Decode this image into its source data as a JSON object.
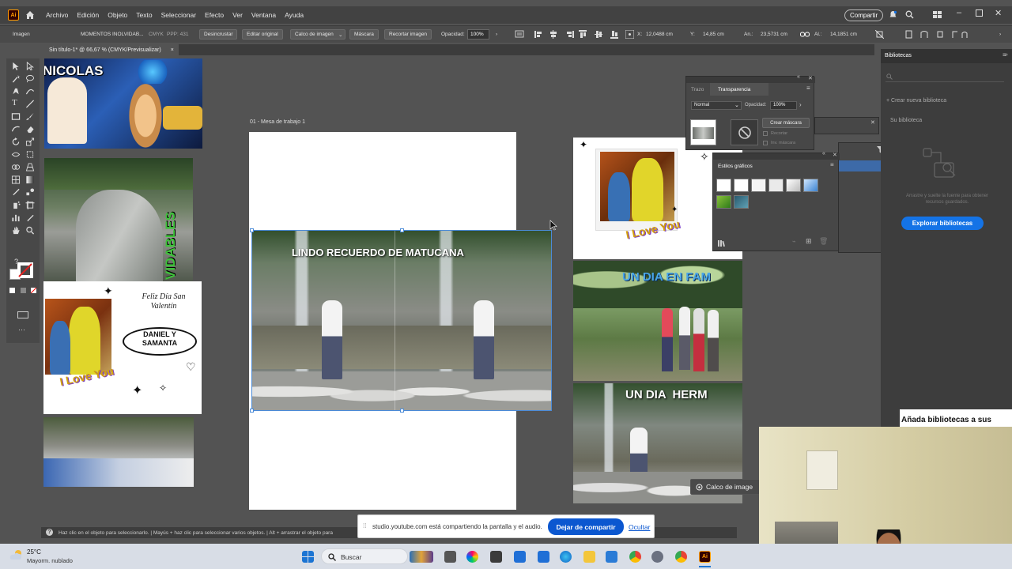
{
  "app": {
    "logo": "Ai",
    "menus": [
      "Archivo",
      "Edición",
      "Objeto",
      "Texto",
      "Seleccionar",
      "Efecto",
      "Ver",
      "Ventana",
      "Ayuda"
    ],
    "share_label": "Compartir"
  },
  "control_bar": {
    "object_type": "Imagen",
    "file_name": "MOMENTOS INOLVIDAB...",
    "color_mode": "CMYK",
    "ppp": "PPP: 431",
    "unlink": "Desincrustar",
    "edit_original": "Editar original",
    "image_trace": "Calco de imagen",
    "mask": "Máscara",
    "crop_image": "Recortar imagen",
    "opacity_label": "Opacidad:",
    "opacity_value": "100%",
    "x_label": "X:",
    "x_value": "12,0488 cm",
    "y_label": "Y:",
    "y_value": "14,85 cm",
    "w_label": "An.:",
    "w_value": "23,5731 cm",
    "h_label": "Al.:",
    "h_value": "14,1851 cm"
  },
  "document_tab": {
    "title": "Sin título-1* @ 66,67 % (CMYK/Previsualizar)",
    "close": "×"
  },
  "artboard": {
    "label": "01 - Mesa de trabajo 1"
  },
  "canvas_texts": {
    "nicolas": "NICOLAS",
    "vidables": "VIDABLES",
    "feliz_dia": "Feliz Día San Valentín",
    "names": "DANIEL Y SAMANTA",
    "i_love_you": "I Love You",
    "lindo_recuerdo": "LINDO RECUERDO DE MATUCANA",
    "un_dia_en_fam": "UN DIA EN FAM",
    "un_dia_herm": "UN DIA  HERM"
  },
  "transparency_panel": {
    "tab_stroke": "Trazo",
    "tab_transparency": "Transparencia",
    "blend_mode": "Normal",
    "opacity_label": "Opacidad:",
    "opacity_value": "100%",
    "make_mask": "Crear máscara",
    "clip": "Recortar",
    "invert_mask": "Inv. máscara"
  },
  "graphic_styles_panel": {
    "title": "Estilos gráficos"
  },
  "libraries_panel": {
    "title": "Bibliotecas",
    "create_new": "Crear nueva biblioteca",
    "your_library": "Su biblioteca",
    "hint": "Arrastre y suelte la fuente para obtener recursos guardados.",
    "explore": "Explorar bibliotecas",
    "tooltip": "Añada bibliotecas a sus"
  },
  "floating": {
    "image_trace": "Calco de image"
  },
  "status_bar": {
    "text": "Haz clic en el objeto para seleccionarlo.  |  Mayús + haz clic para seleccionar varios objetos.  |  Alt + arrastrar el objeto para"
  },
  "share_banner": {
    "text": "studio.youtube.com está compartiendo la pantalla y el audio.",
    "stop": "Dejar de compartir",
    "hide": "Ocultar"
  },
  "taskbar": {
    "weather_temp": "25°C",
    "weather_desc": "Mayorm. nublado",
    "search": "Buscar"
  },
  "colors": {
    "accent": "#1473e6",
    "ai_orange": "#ff9a00",
    "share_blue": "#0b57d0"
  }
}
